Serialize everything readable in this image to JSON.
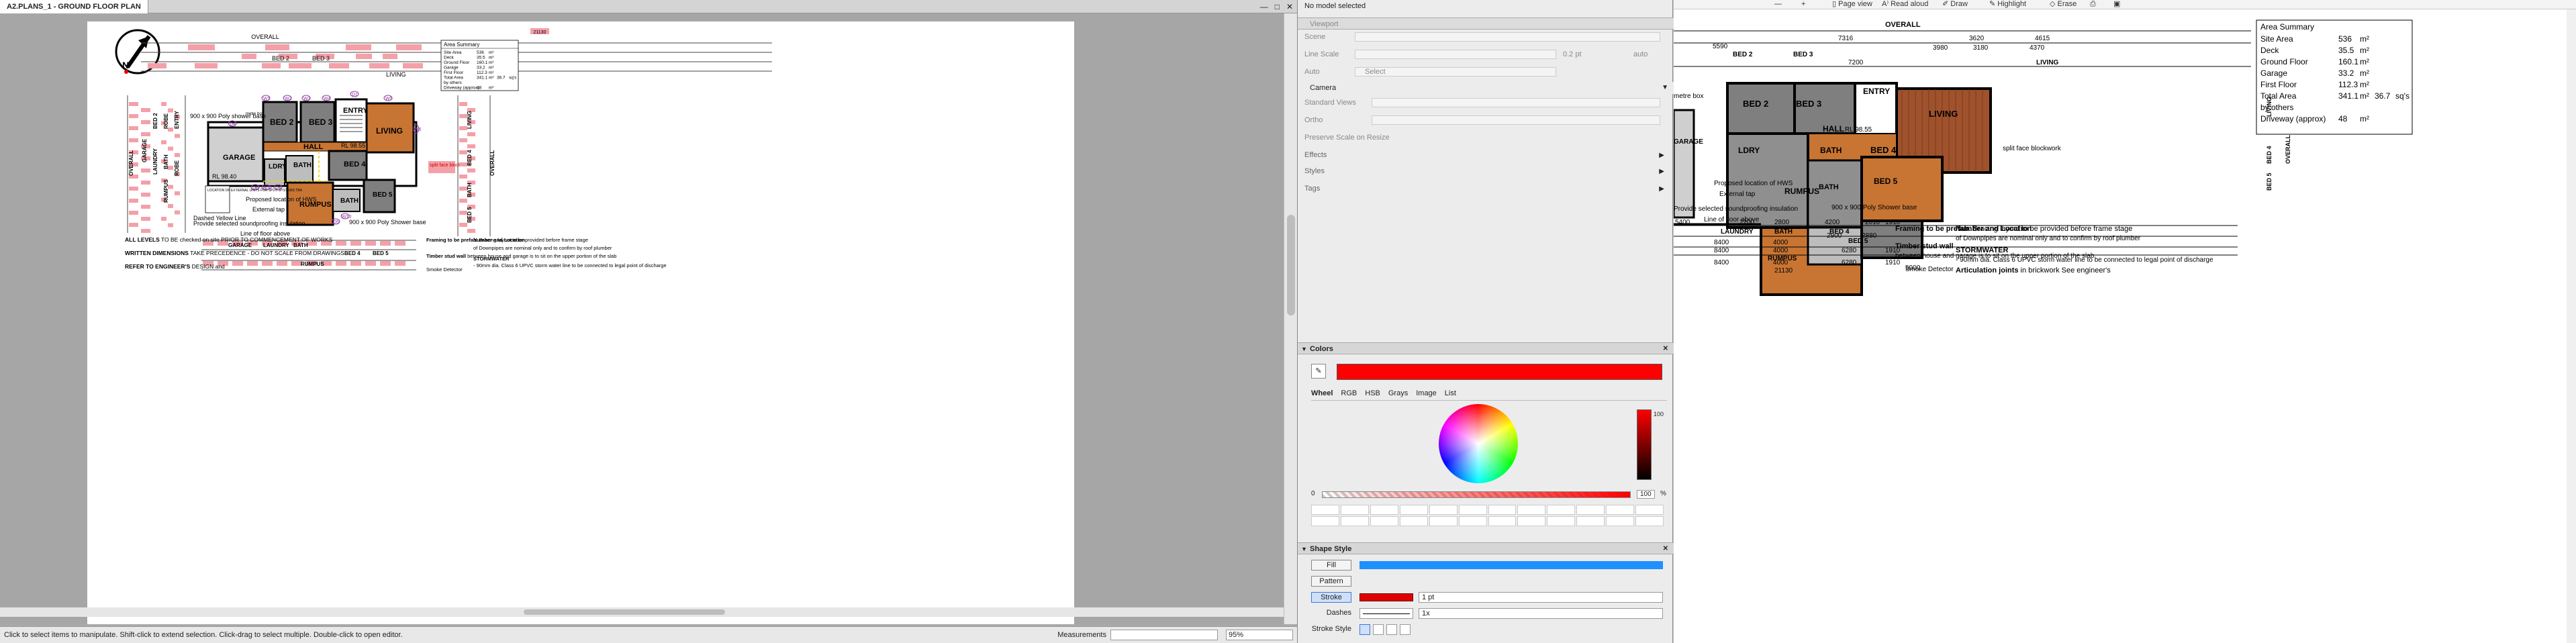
{
  "left_window": {
    "tab_title": "A2.PLANS_1 - GROUND FLOOR PLAN",
    "controls": [
      "—",
      "□",
      "✕"
    ],
    "status_hint": "Click to select items to manipulate. Shift-click to extend selection. Click-drag to select multiple. Double-click to open editor.",
    "measurements_label": "Measurements",
    "zoom_value": "95%"
  },
  "plan": {
    "overall_top": "OVERALL",
    "overall_top_dim": "21130",
    "rooms": [
      "BED 2",
      "BED 3",
      "ENTRY",
      "LIVING",
      "HALL",
      "GARAGE",
      "LDRY",
      "BATH",
      "BED 4",
      "RUMPUS",
      "BATH",
      "BED 5"
    ],
    "rl_1": "RL 98.55",
    "rl_2": "RL 98.40",
    "labels": {
      "shower": "900 x 900 Poly shower base",
      "shower2": "900 x 900 Poly Shower base",
      "hws": "Proposed location of HWS",
      "tap": "External tap",
      "yellow": "Dashed Yellow Line",
      "sound": "Provide selected soundproofing insulation",
      "floor_above": "Line of floor above",
      "split_face": "split face blockwork",
      "metre_box": "metre box",
      "external_units": "LOCATION OF EXTERNAL UNITS FOR SPLIT SYSTEMS TBA"
    },
    "windows": [
      "W1",
      "W2",
      "W3",
      "W4",
      "D1",
      "W5",
      "W6",
      "D4",
      "D6",
      "W12",
      "D4",
      "D5",
      "W10"
    ],
    "side_labels_left": [
      "OVERALL",
      "GARAGE",
      "LAUNDRY",
      "BED 2",
      "BATH",
      "RUMPUS",
      "ROBE",
      "ROBE",
      "ENTRY"
    ],
    "side_labels_right": [
      "LIVING",
      "BED 4",
      "BATH",
      "BED 5",
      "OVERALL"
    ],
    "bottom_rooms": [
      "GARAGE",
      "LAUNDRY",
      "BATH",
      "BED 4",
      "RUMPUS",
      "BED 5"
    ],
    "area_summary": {
      "title": "Area Summary",
      "rows": [
        {
          "label": "Site Area",
          "value": "536",
          "unit": "m²"
        },
        {
          "label": "Deck",
          "value": "35.5",
          "unit": "m²"
        },
        {
          "label": "Ground Floor",
          "value": "160.1",
          "unit": "m²"
        },
        {
          "label": "Garage",
          "value": "33.2",
          "unit": "m²"
        },
        {
          "label": "First Floor",
          "value": "112.3",
          "unit": "m²"
        },
        {
          "label": "Total Area",
          "value": "341.1",
          "unit": "m²",
          "extra": "36.7",
          "extra_unit": "sq's"
        }
      ],
      "by_others": "by others",
      "driveway": {
        "label": "Driveway (approx)",
        "value": "48",
        "unit": "m²"
      }
    },
    "notes": {
      "levels_b": "ALL LEVELS",
      "levels": " TO BE checked on site PRIOR TO COMMENCEMENT OF WORKS",
      "written_b": "WRITTEN DIMENSIONS",
      "written": " TAKE PRECEDENCE - DO NOT SCALE FROM DRAWINGS",
      "engineer_b": "REFER TO ENGINEER'S",
      "engineer": " DESIGN and",
      "framing_b": "Framing to be prefab",
      "framing": ". Bracing layout to be provided before frame stage",
      "timber_b": "Timber stud wall",
      "timber": " between house and garage is to sit on the upper portion of the slab",
      "number_b": "Number and Location",
      "number": " of Downpipes are nominal only and to confirm by roof plumber",
      "storm_b": "STORMWATER",
      "storm": " - 90mm dia. Class 6 UPVC storm water line to be connected to legal point of discharge",
      "artic_b": "Articulation joints",
      "artic": " in brickwork See engineer's",
      "smoke": "Smoke Detector"
    }
  },
  "inspector": {
    "header": "No model selected",
    "viewport": "Viewport",
    "scene": "Scene",
    "line_scale": "Line Scale",
    "line_scale_value": "0.2 pt",
    "line_scale_auto": "auto",
    "auto": "Auto",
    "auto_select": "Select",
    "camera": "Camera",
    "standard_views": "Standard Views",
    "ortho": "Ortho",
    "preserve": "Preserve Scale on Resize",
    "effects": "Effects",
    "styles": "Styles",
    "tags": "Tags",
    "colors": "Colors",
    "color_tabs": [
      "Wheel",
      "RGB",
      "HSB",
      "Grays",
      "Image",
      "List"
    ],
    "slider_min": "0",
    "slider_value": "100",
    "slider_pct": "%",
    "brightness_value": "100",
    "shape_style": "Shape Style",
    "fill": "Fill",
    "pattern": "Pattern",
    "stroke": "Stroke",
    "stroke_value": "1 pt",
    "dashes": "Dashes",
    "dashes_value": "1x",
    "stroke_style": "Stroke Style",
    "current_color": "#ff0000"
  },
  "right_window": {
    "toolbar": [
      "Page view",
      "Read aloud",
      "Draw",
      "Highlight",
      "Erase"
    ],
    "overall": "OVERALL",
    "dims_top": [
      "7316",
      "3620",
      "4615"
    ],
    "dims_row2": [
      "5590",
      "7200",
      "1910"
    ],
    "dims_row3": [
      "3980",
      "3180",
      "4370"
    ],
    "bottom_dims": [
      "5400",
      "2200",
      "2800",
      "4200",
      "2010",
      "1910"
    ],
    "bottom_rooms": [
      "LAUNDRY",
      "BATH",
      "BED 4",
      "BED 5"
    ],
    "bottom_row2": [
      "8400",
      "4000",
      "2900",
      "2880"
    ],
    "bottom_row3": [
      "8400",
      "4000",
      "6280",
      "1910"
    ],
    "rumpus": "RUMPUS",
    "bottom_row4": [
      "8400",
      "4000",
      "6280",
      "1910"
    ],
    "total_bottom": "21130",
    "bottom_last": "5000"
  },
  "colors": {
    "accent": "#ff0000",
    "label_red": "#f4a0a8",
    "purple": "#8a3a9e",
    "wood": "#c87533"
  }
}
